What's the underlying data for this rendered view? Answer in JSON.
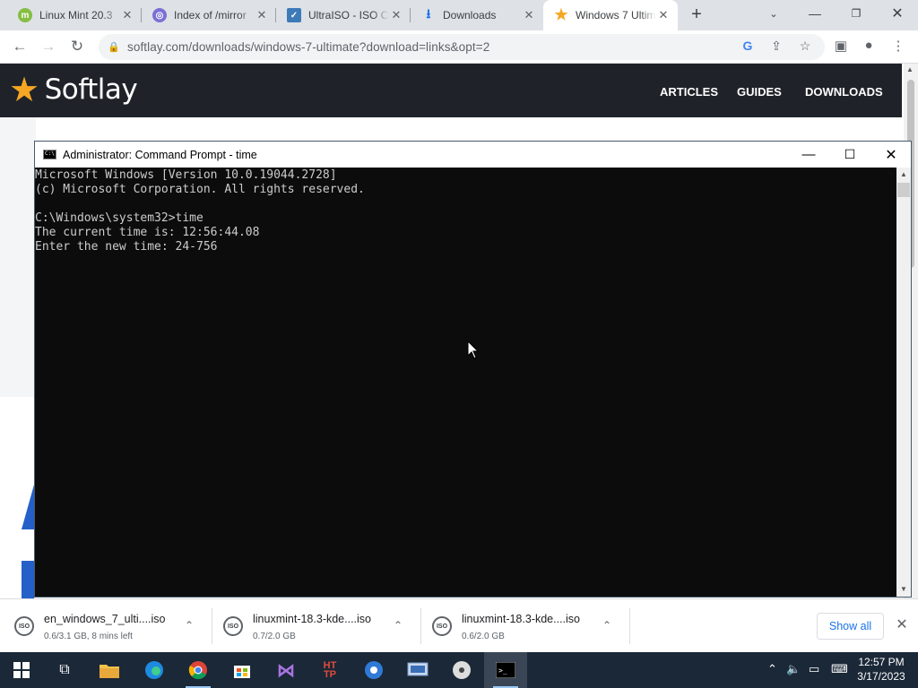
{
  "browser": {
    "tabs": [
      {
        "label": "Linux Mint 20.3",
        "favicon": "linux-mint-icon"
      },
      {
        "label": "Index of /mirror",
        "favicon": "globe-icon"
      },
      {
        "label": "UltraISO - ISO C",
        "favicon": "ultraiso-icon"
      },
      {
        "label": "Downloads",
        "favicon": "download-icon"
      },
      {
        "label": "Windows 7 Ultim",
        "favicon": "star-icon",
        "active": true
      }
    ],
    "url": "softlay.com/downloads/windows-7-ultimate?download=links&opt=2"
  },
  "site": {
    "logo_text": "Softlay",
    "nav": [
      "ARTICLES",
      "GUIDES",
      "DOWNLOADS"
    ]
  },
  "cmd": {
    "title": "Administrator:  Command Prompt - time",
    "lines": [
      "Microsoft Windows [Version 10.0.19044.2728]",
      "(c) Microsoft Corporation. All rights reserved.",
      "",
      "C:\\Windows\\system32>time",
      "The current time is: 12:56:44.08",
      "Enter the new time: 24-756"
    ]
  },
  "downloads": {
    "items": [
      {
        "name": "en_windows_7_ulti....iso",
        "status": "0.6/3.1 GB, 8 mins left"
      },
      {
        "name": "linuxmint-18.3-kde....iso",
        "status": "0.7/2.0 GB"
      },
      {
        "name": "linuxmint-18.3-kde....iso",
        "status": "0.6/2.0 GB"
      }
    ],
    "show_all": "Show all"
  },
  "taskbar": {
    "apps": [
      "start-icon",
      "task-view-icon",
      "file-explorer-icon",
      "edge-icon",
      "chrome-icon",
      "store-icon",
      "visual-studio-icon",
      "http-tool-icon",
      "app-icon",
      "network-app-icon",
      "media-icon",
      "command-prompt-icon"
    ],
    "time": "12:57 PM",
    "date": "3/17/2023"
  }
}
